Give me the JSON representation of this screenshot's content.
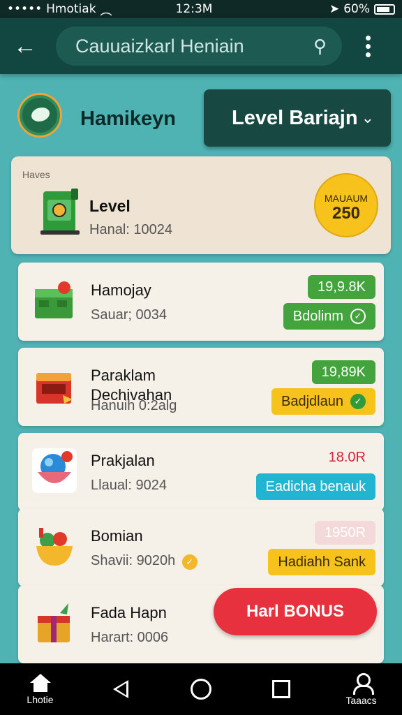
{
  "status_bar": {
    "carrier": "Hmotiak",
    "time": "12:3M",
    "battery": "60%"
  },
  "app_bar": {
    "search_text": "Cauuaizkarl Heniain",
    "icons": [
      "back-arrow-icon",
      "search-icon",
      "more-vert-icon"
    ]
  },
  "header": {
    "brand_name": "Hamikeyn",
    "level_dropdown_label": "Level Bariajn"
  },
  "top_card": {
    "section_label": "Haves",
    "title": "Level",
    "subtitle": "Hanal: 10024",
    "badge_text": "MAUAUM",
    "badge_value": "250"
  },
  "items": [
    {
      "name": "Hamojay",
      "sub": "Sauar; 0034",
      "price": "19,9.8K",
      "action": "Bdolinm",
      "action_style": "green",
      "icon": "green-crate-icon"
    },
    {
      "name": "Paraklam\nDechivahan",
      "sub": "Hanuih 0:2alg",
      "price": "19,89K",
      "action": "Badjdlaun",
      "action_style": "yellow",
      "icon": "red-chest-icon"
    },
    {
      "name": "Prakjalan",
      "sub": "Llaual: 9024",
      "price": "18.0R",
      "action": "Eadicha benauk",
      "action_style": "cyan",
      "icon": "blue-orb-bowl-icon"
    },
    {
      "name": "Bomian",
      "sub": "Shavii: 9020h",
      "price": "1950R",
      "action": "Hadiahh Sank",
      "action_style": "yellow",
      "icon": "fruit-bowl-icon"
    },
    {
      "name": "Fada Hapn",
      "sub": "Harart: 0006",
      "bonus_label": "Harl BONUS",
      "icon": "gift-box-icon"
    }
  ],
  "nav": {
    "home_label": "Lhotie",
    "profile_label": "Taaacs"
  },
  "colors": {
    "background": "#4fb3b3",
    "app_bar": "#124640",
    "green": "#43a33d",
    "yellow": "#f6c21b",
    "cyan": "#22b5d2",
    "red": "#e8313e"
  }
}
